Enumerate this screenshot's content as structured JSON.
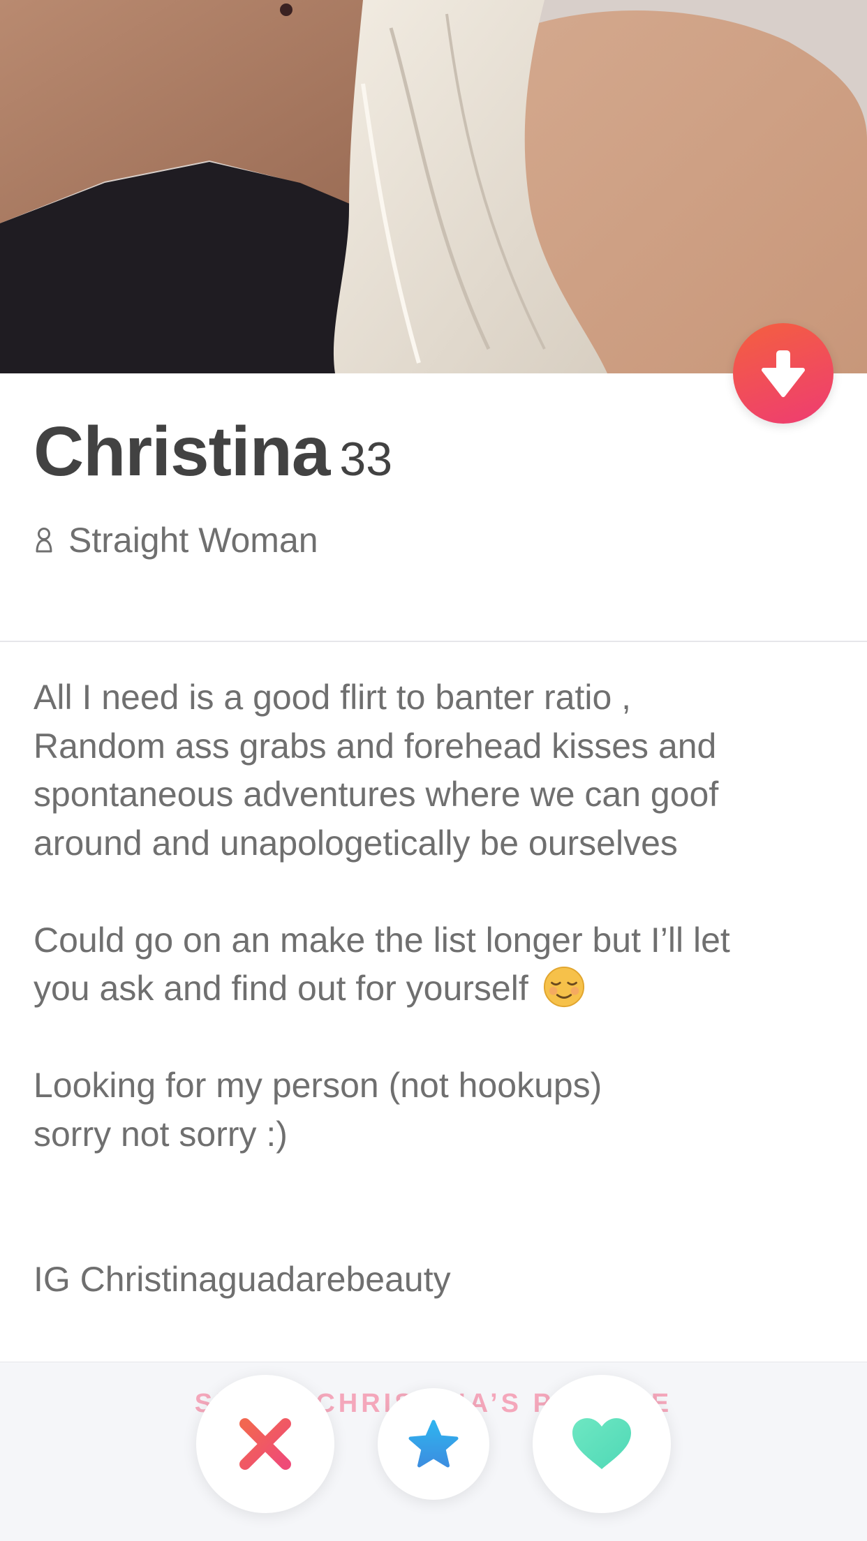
{
  "profile": {
    "name": "Christina",
    "age": "33",
    "orientation": "Straight Woman",
    "orientation_icon": "person-icon"
  },
  "bio": {
    "lines": [
      "All I need is a good flirt to banter ratio ,",
      "Random ass grabs and forehead kisses and",
      "spontaneous adventures where we can goof",
      "around and unapologetically be ourselves",
      "",
      "Could go on an make the list longer but I’ll let",
      "you ask and find out for yourself",
      "",
      "Looking for my person  (not hookups)",
      "sorry not sorry :)",
      "",
      "",
      "IG Christinaguadarebeauty"
    ],
    "emoji": "smiling-face-icon"
  },
  "actions": {
    "share_label": "SHARE CHRISTINA’S PROFILE",
    "collapse_icon": "arrow-down-icon",
    "nope_icon": "close-icon",
    "super_like_icon": "star-icon",
    "like_icon": "heart-icon"
  },
  "colors": {
    "brand_gradient_start": "#f4603f",
    "brand_gradient_end": "#ee3c72",
    "nope": "#f0506e",
    "super_like": "#3aa3e8",
    "like": "#5fe2bd",
    "share_text": "#f4a7bb"
  }
}
